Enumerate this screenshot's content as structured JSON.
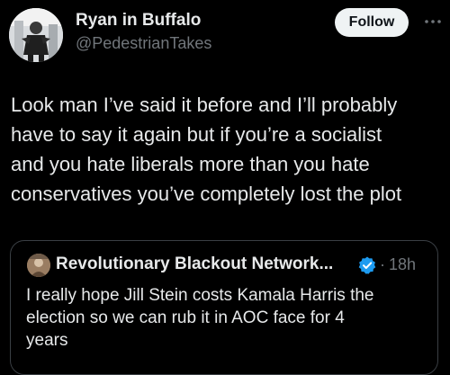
{
  "tweet": {
    "author_name": "Ryan in Buffalo",
    "author_handle": "@PedestrianTakes",
    "follow_label": "Follow",
    "more_icon": "more-horizontal-icon",
    "body_lines": [
      "Look man I’ve said it before and I’ll probably",
      "have to say it again but if you’re a socialist",
      "and you hate liberals more than you hate",
      "conservatives you’ve completely lost the plot"
    ]
  },
  "quote": {
    "author_name": "Revolutionary Blackout Network...",
    "verified_icon": "verified-badge-icon",
    "dot": "·",
    "time": "18h",
    "body_lines": [
      "I really hope Jill Stein costs Kamala Harris the",
      "election so we can rub it in AOC face for 4",
      "years"
    ]
  },
  "colors": {
    "background": "#000000",
    "text_primary": "#e7e9ea",
    "text_secondary": "#71767b",
    "follow_bg": "#eff3f4",
    "verified_blue": "#1d9bf0",
    "card_border": "#3a3f44"
  }
}
